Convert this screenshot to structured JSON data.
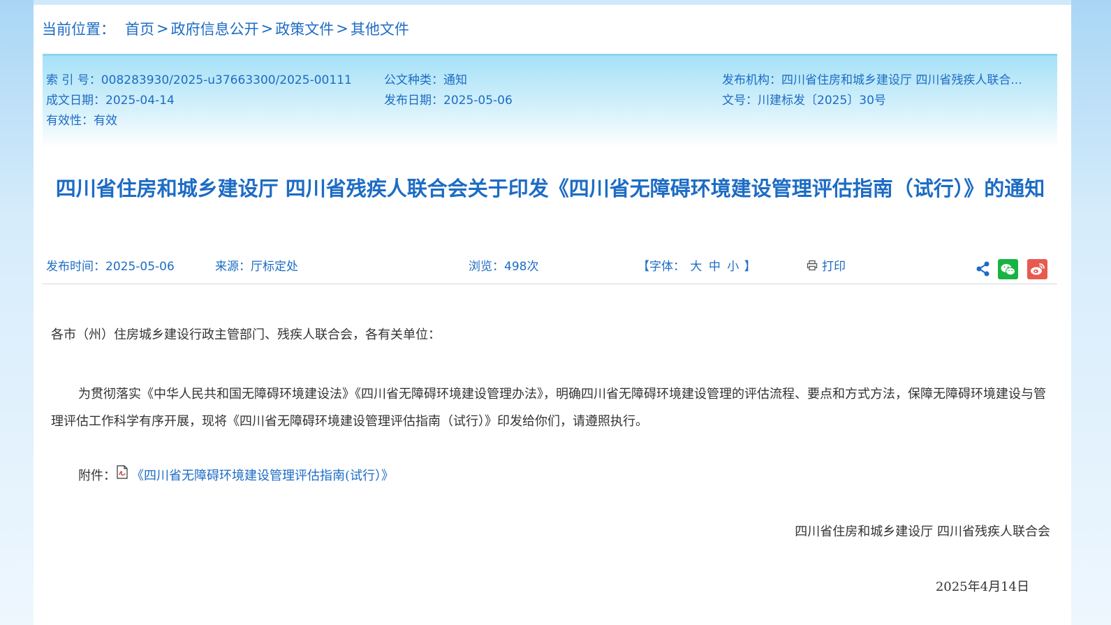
{
  "breadcrumb": {
    "label": "当前位置：",
    "items": [
      "首页",
      "政府信息公开",
      "政策文件",
      "其他文件"
    ],
    "separator": ">"
  },
  "meta": {
    "index_no": "索 引 号：008283930/2025-u37663300/2025-00111",
    "doc_type": "公文种类：通知",
    "publisher": "发布机构：四川省住房和城乡建设厅  四川省残疾人联合...",
    "written_date": "成文日期：2025-04-14",
    "publish_date": "发布日期：2025-05-06",
    "doc_no": "文号：川建标发〔2025〕30号",
    "validity": "有效性：有效"
  },
  "title": "四川省住房和城乡建设厅 四川省残疾人联合会关于印发《四川省无障碍环境建设管理评估指南（试行）》的通知",
  "info": {
    "publish_time": "发布时间：2025-05-06",
    "source": "来源：厅标定处",
    "views": "浏览：498次",
    "font_label_open": "【字体：",
    "font_large": "大",
    "font_medium": "中",
    "font_small": "小",
    "font_label_close": "】",
    "print": "打印"
  },
  "content": {
    "greeting": "各市（州）住房城乡建设行政主管部门、残疾人联合会，各有关单位：",
    "paragraph": "为贯彻落实《中华人民共和国无障碍环境建设法》《四川省无障碍环境建设管理办法》，明确四川省无障碍环境建设管理的评估流程、要点和方式方法，保障无障碍环境建设与管理评估工作科学有序开展，现将《四川省无障碍环境建设管理评估指南（试行）》印发给你们，请遵照执行。",
    "attachment_label": "附件：",
    "attachment_link": "《四川省无障碍环境建设管理评估指南(试行）》",
    "signature": "四川省住房和城乡建设厅  四川省残疾人联合会",
    "date": "2025年4月14日"
  },
  "colors": {
    "accent": "#1d6cc4",
    "wechat": "#17b443",
    "weibo": "#e8594f",
    "share": "#1d6cc4"
  }
}
